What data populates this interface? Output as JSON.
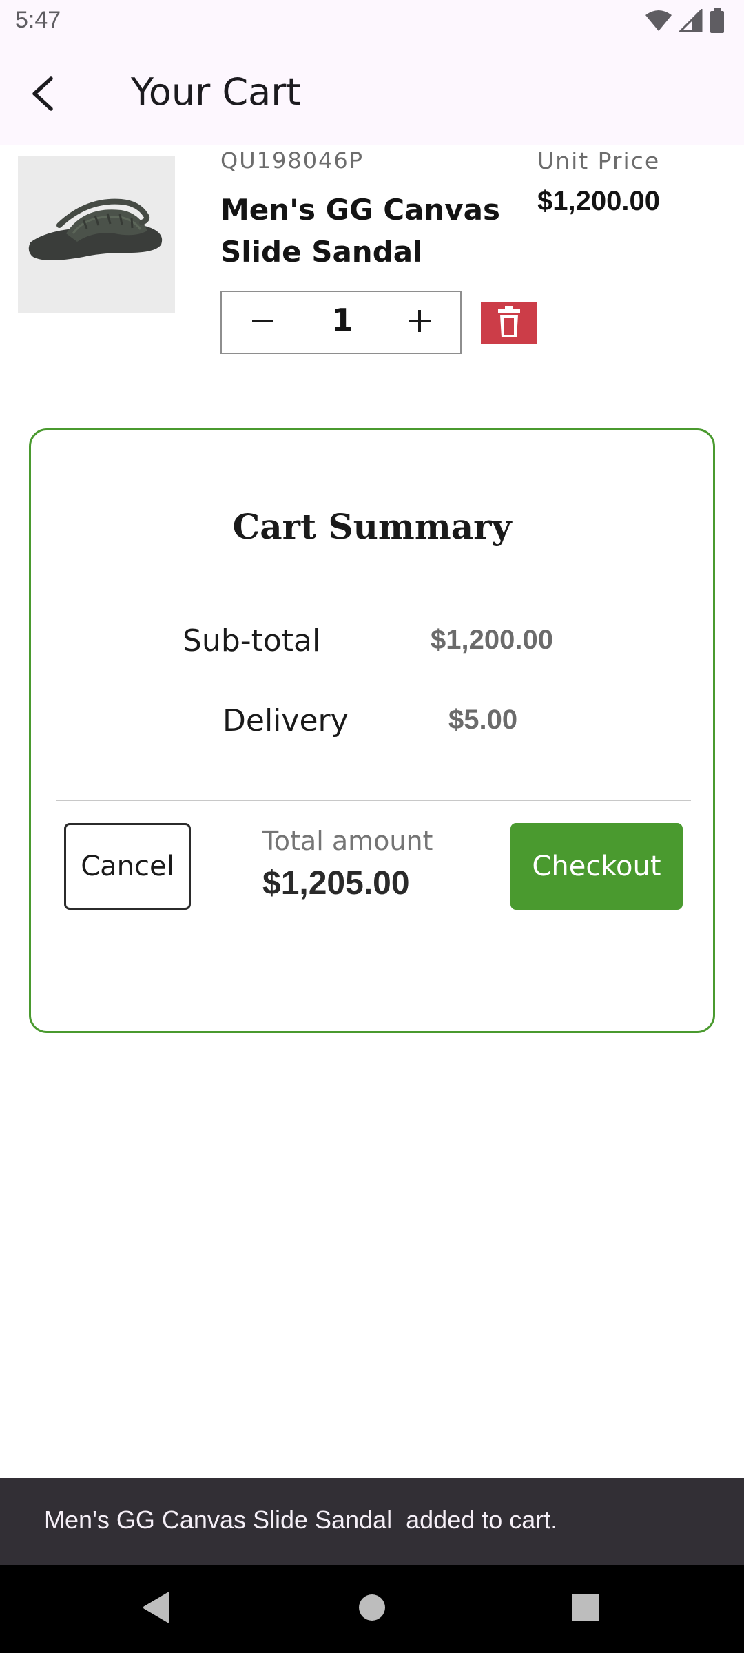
{
  "status_bar": {
    "time": "5:47",
    "icons": [
      "wifi-icon",
      "signal-icon",
      "battery-icon"
    ]
  },
  "app_bar": {
    "back_icon": "back-arrow-icon",
    "title": "Your Cart"
  },
  "cart_item": {
    "image": "slide-sandal-image",
    "sku": "QU198046P",
    "name": "Men's GG Canvas Slide Sandal",
    "unit_price_label": "Unit Price",
    "unit_price": "$1,200.00",
    "quantity": "1",
    "minus_icon": "minus-icon",
    "plus_icon": "plus-icon",
    "delete_icon": "trash-icon"
  },
  "summary": {
    "title": "Cart Summary",
    "subtotal_label": "Sub-total",
    "subtotal_value": "$1,200.00",
    "delivery_label": "Delivery",
    "delivery_value": "$5.00",
    "total_label": "Total amount",
    "total_value": "$1,205.00",
    "cancel_label": "Cancel",
    "checkout_label": "Checkout"
  },
  "snackbar": {
    "message": "Men's GG Canvas Slide Sandal  added to cart."
  },
  "nav_bar": {
    "icons": [
      "nav-back-icon",
      "nav-home-icon",
      "nav-recents-icon"
    ]
  },
  "colors": {
    "app_bar_bg": "#fdf7fe",
    "accent_green": "#4a9a2f",
    "delete_red": "#cc3d48",
    "snackbar_bg": "#322f35"
  }
}
